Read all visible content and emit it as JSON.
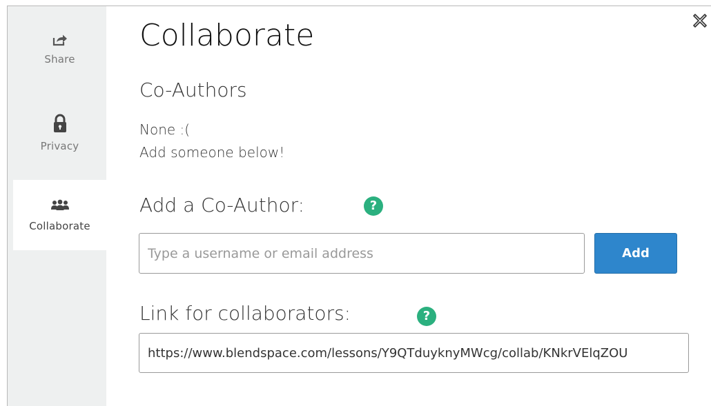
{
  "sidebar": {
    "items": [
      {
        "label": "Share",
        "icon": "share-icon",
        "active": false
      },
      {
        "label": "Privacy",
        "icon": "lock-icon",
        "active": false
      },
      {
        "label": "Collaborate",
        "icon": "people-icon",
        "active": true
      }
    ]
  },
  "main": {
    "title": "Collaborate",
    "coauthors_heading": "Co-Authors",
    "none_text": "None :(",
    "add_below_text": "Add someone below!",
    "add_coauthor_heading": "Add a Co-Author:",
    "add_input": {
      "placeholder": "Type a username or email address",
      "value": ""
    },
    "add_button_label": "Add",
    "link_heading": "Link for collaborators:",
    "link_value": "https://www.blendspace.com/lessons/Y9QTduyknyMWcg/collab/KNkrVElqZOU"
  },
  "help_icon_glyph": "?",
  "colors": {
    "help_green": "#2bb07f",
    "add_blue": "#2e86cc",
    "sidebar_bg": "#eef0f0"
  }
}
